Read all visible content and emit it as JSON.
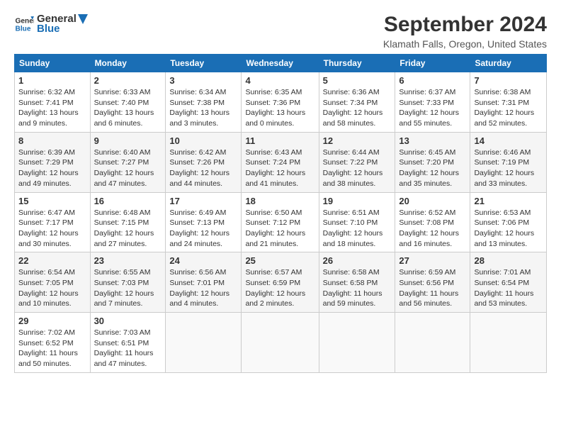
{
  "logo": {
    "line1": "General",
    "line2": "Blue"
  },
  "title": "September 2024",
  "subtitle": "Klamath Falls, Oregon, United States",
  "headers": [
    "Sunday",
    "Monday",
    "Tuesday",
    "Wednesday",
    "Thursday",
    "Friday",
    "Saturday"
  ],
  "weeks": [
    [
      {
        "day": "1",
        "sunrise": "Sunrise: 6:32 AM",
        "sunset": "Sunset: 7:41 PM",
        "daylight": "Daylight: 13 hours and 9 minutes."
      },
      {
        "day": "2",
        "sunrise": "Sunrise: 6:33 AM",
        "sunset": "Sunset: 7:40 PM",
        "daylight": "Daylight: 13 hours and 6 minutes."
      },
      {
        "day": "3",
        "sunrise": "Sunrise: 6:34 AM",
        "sunset": "Sunset: 7:38 PM",
        "daylight": "Daylight: 13 hours and 3 minutes."
      },
      {
        "day": "4",
        "sunrise": "Sunrise: 6:35 AM",
        "sunset": "Sunset: 7:36 PM",
        "daylight": "Daylight: 13 hours and 0 minutes."
      },
      {
        "day": "5",
        "sunrise": "Sunrise: 6:36 AM",
        "sunset": "Sunset: 7:34 PM",
        "daylight": "Daylight: 12 hours and 58 minutes."
      },
      {
        "day": "6",
        "sunrise": "Sunrise: 6:37 AM",
        "sunset": "Sunset: 7:33 PM",
        "daylight": "Daylight: 12 hours and 55 minutes."
      },
      {
        "day": "7",
        "sunrise": "Sunrise: 6:38 AM",
        "sunset": "Sunset: 7:31 PM",
        "daylight": "Daylight: 12 hours and 52 minutes."
      }
    ],
    [
      {
        "day": "8",
        "sunrise": "Sunrise: 6:39 AM",
        "sunset": "Sunset: 7:29 PM",
        "daylight": "Daylight: 12 hours and 49 minutes."
      },
      {
        "day": "9",
        "sunrise": "Sunrise: 6:40 AM",
        "sunset": "Sunset: 7:27 PM",
        "daylight": "Daylight: 12 hours and 47 minutes."
      },
      {
        "day": "10",
        "sunrise": "Sunrise: 6:42 AM",
        "sunset": "Sunset: 7:26 PM",
        "daylight": "Daylight: 12 hours and 44 minutes."
      },
      {
        "day": "11",
        "sunrise": "Sunrise: 6:43 AM",
        "sunset": "Sunset: 7:24 PM",
        "daylight": "Daylight: 12 hours and 41 minutes."
      },
      {
        "day": "12",
        "sunrise": "Sunrise: 6:44 AM",
        "sunset": "Sunset: 7:22 PM",
        "daylight": "Daylight: 12 hours and 38 minutes."
      },
      {
        "day": "13",
        "sunrise": "Sunrise: 6:45 AM",
        "sunset": "Sunset: 7:20 PM",
        "daylight": "Daylight: 12 hours and 35 minutes."
      },
      {
        "day": "14",
        "sunrise": "Sunrise: 6:46 AM",
        "sunset": "Sunset: 7:19 PM",
        "daylight": "Daylight: 12 hours and 33 minutes."
      }
    ],
    [
      {
        "day": "15",
        "sunrise": "Sunrise: 6:47 AM",
        "sunset": "Sunset: 7:17 PM",
        "daylight": "Daylight: 12 hours and 30 minutes."
      },
      {
        "day": "16",
        "sunrise": "Sunrise: 6:48 AM",
        "sunset": "Sunset: 7:15 PM",
        "daylight": "Daylight: 12 hours and 27 minutes."
      },
      {
        "day": "17",
        "sunrise": "Sunrise: 6:49 AM",
        "sunset": "Sunset: 7:13 PM",
        "daylight": "Daylight: 12 hours and 24 minutes."
      },
      {
        "day": "18",
        "sunrise": "Sunrise: 6:50 AM",
        "sunset": "Sunset: 7:12 PM",
        "daylight": "Daylight: 12 hours and 21 minutes."
      },
      {
        "day": "19",
        "sunrise": "Sunrise: 6:51 AM",
        "sunset": "Sunset: 7:10 PM",
        "daylight": "Daylight: 12 hours and 18 minutes."
      },
      {
        "day": "20",
        "sunrise": "Sunrise: 6:52 AM",
        "sunset": "Sunset: 7:08 PM",
        "daylight": "Daylight: 12 hours and 16 minutes."
      },
      {
        "day": "21",
        "sunrise": "Sunrise: 6:53 AM",
        "sunset": "Sunset: 7:06 PM",
        "daylight": "Daylight: 12 hours and 13 minutes."
      }
    ],
    [
      {
        "day": "22",
        "sunrise": "Sunrise: 6:54 AM",
        "sunset": "Sunset: 7:05 PM",
        "daylight": "Daylight: 12 hours and 10 minutes."
      },
      {
        "day": "23",
        "sunrise": "Sunrise: 6:55 AM",
        "sunset": "Sunset: 7:03 PM",
        "daylight": "Daylight: 12 hours and 7 minutes."
      },
      {
        "day": "24",
        "sunrise": "Sunrise: 6:56 AM",
        "sunset": "Sunset: 7:01 PM",
        "daylight": "Daylight: 12 hours and 4 minutes."
      },
      {
        "day": "25",
        "sunrise": "Sunrise: 6:57 AM",
        "sunset": "Sunset: 6:59 PM",
        "daylight": "Daylight: 12 hours and 2 minutes."
      },
      {
        "day": "26",
        "sunrise": "Sunrise: 6:58 AM",
        "sunset": "Sunset: 6:58 PM",
        "daylight": "Daylight: 11 hours and 59 minutes."
      },
      {
        "day": "27",
        "sunrise": "Sunrise: 6:59 AM",
        "sunset": "Sunset: 6:56 PM",
        "daylight": "Daylight: 11 hours and 56 minutes."
      },
      {
        "day": "28",
        "sunrise": "Sunrise: 7:01 AM",
        "sunset": "Sunset: 6:54 PM",
        "daylight": "Daylight: 11 hours and 53 minutes."
      }
    ],
    [
      {
        "day": "29",
        "sunrise": "Sunrise: 7:02 AM",
        "sunset": "Sunset: 6:52 PM",
        "daylight": "Daylight: 11 hours and 50 minutes."
      },
      {
        "day": "30",
        "sunrise": "Sunrise: 7:03 AM",
        "sunset": "Sunset: 6:51 PM",
        "daylight": "Daylight: 11 hours and 47 minutes."
      },
      null,
      null,
      null,
      null,
      null
    ]
  ]
}
